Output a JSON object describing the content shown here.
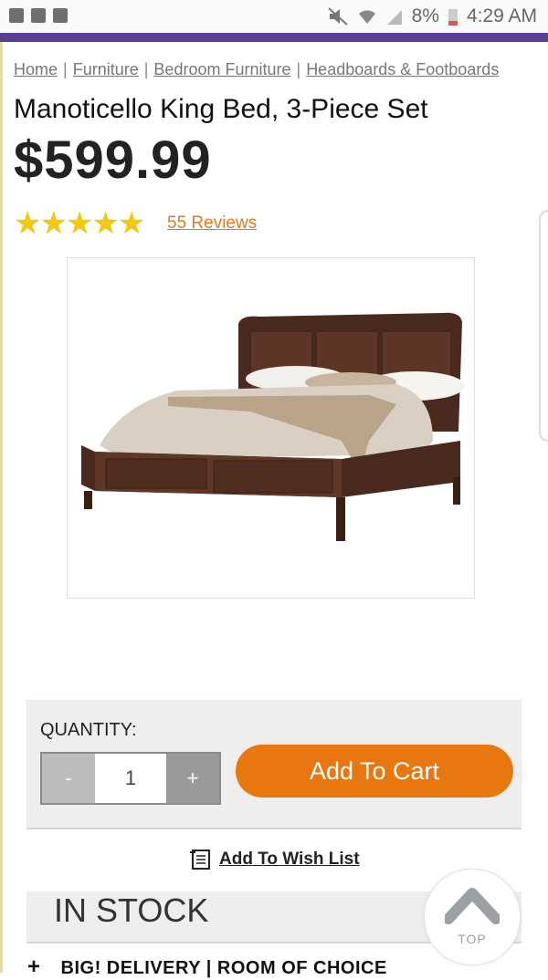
{
  "status_bar": {
    "battery": "8%",
    "time": "4:29 AM"
  },
  "breadcrumb": {
    "items": [
      "Home",
      "Furniture",
      "Bedroom Furniture",
      "Headboards & Footboards"
    ],
    "separator": "|"
  },
  "product": {
    "title": "Manoticello King Bed, 3-Piece Set",
    "price": "$599.99",
    "rating": 4.5,
    "rating_max": 5,
    "reviews_label": "55 Reviews"
  },
  "purchase": {
    "quantity_label": "QUANTITY:",
    "quantity_value": "1",
    "minus_label": "-",
    "plus_label": "+",
    "add_to_cart_label": "Add To Cart",
    "wishlist_label": "Add To Wish List",
    "stock_status": "IN STOCK",
    "delivery_label": "BIG! DELIVERY | ROOM OF CHOICE",
    "delivery_expand": "+"
  },
  "top_button": {
    "label": "TOP"
  },
  "colors": {
    "accent_purple": "#5a3e8f",
    "cart_orange": "#e8770f",
    "star_yellow": "#f2c90f",
    "link_orange": "#e07a1a"
  },
  "icons": [
    "alert-icon",
    "mail-icon",
    "gmail-icon",
    "mute-icon",
    "wifi-icon",
    "signal-icon",
    "battery-icon",
    "wishlist-icon",
    "chevron-up-icon"
  ]
}
